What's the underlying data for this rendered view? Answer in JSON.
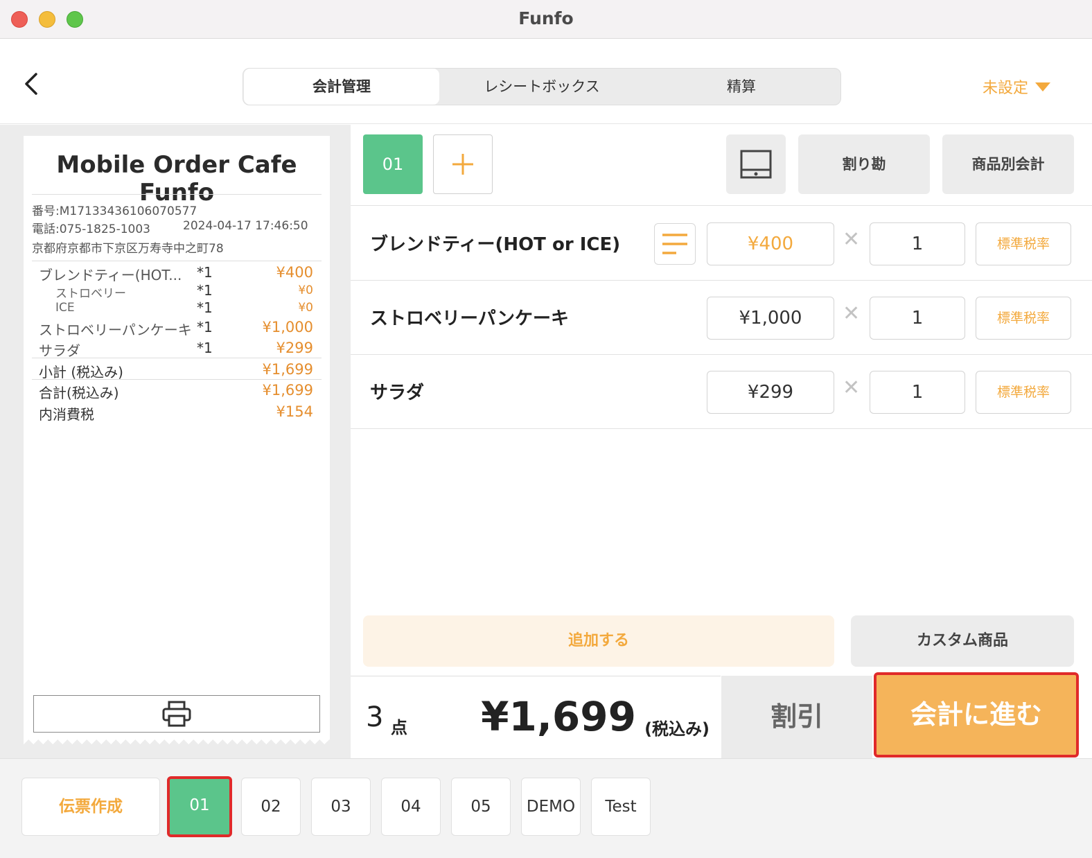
{
  "window": {
    "title": "Funfo"
  },
  "header": {
    "tabs": [
      {
        "label": "会計管理",
        "active": true
      },
      {
        "label": "レシートボックス",
        "active": false
      },
      {
        "label": "精算",
        "active": false
      }
    ],
    "status_label": "未設定"
  },
  "receipt": {
    "shop_name": "Mobile Order Cafe Funfo",
    "number": "番号:M17133436106070577",
    "phone": "電話:075-1825-1003",
    "datetime": "2024-04-17 17:46:50",
    "address": "京都府京都市下京区万寿寺中之町78",
    "items": [
      {
        "name": "ブレンドティー(HOT...",
        "qty": "*1",
        "price": "¥400"
      },
      {
        "name": "ストロベリー",
        "qty": "*1",
        "price": "¥0"
      },
      {
        "name": "ICE",
        "qty": "*1",
        "price": "¥0"
      },
      {
        "name": "ストロベリーパンケーキ",
        "qty": "*1",
        "price": "¥1,000"
      },
      {
        "name": "サラダ",
        "qty": "*1",
        "price": "¥299"
      }
    ],
    "subtotal_label": "小計 (税込み)",
    "subtotal": "¥1,699",
    "total_label": "合計(税込み)",
    "total": "¥1,699",
    "tax_label": "内消費税",
    "tax": "¥154"
  },
  "toolbar": {
    "active_slip": "01",
    "split_label": "割り勘",
    "by_item_label": "商品別会計"
  },
  "order": [
    {
      "name": "ブレンドティー(HOT or ICE)",
      "price": "¥400",
      "qty": "1",
      "tax": "標準税率"
    },
    {
      "name": "ストロベリーパンケーキ",
      "price": "¥1,000",
      "qty": "1",
      "tax": "標準税率"
    },
    {
      "name": "サラダ",
      "price": "¥299",
      "qty": "1",
      "tax": "標準税率"
    }
  ],
  "times_symbol": "✕",
  "actions": {
    "add_label": "追加する",
    "custom_label": "カスタム商品"
  },
  "totals": {
    "count": "3",
    "count_unit": "点",
    "amount": "¥1,699",
    "tax_note": "(税込み)",
    "discount_label": "割引",
    "checkout_label": "会計に進む"
  },
  "bottom": {
    "create_slip_label": "伝票作成",
    "tabs": [
      "01",
      "02",
      "03",
      "04",
      "05",
      "DEMO",
      "Test"
    ]
  },
  "colors": {
    "accent": "#f3a93d",
    "green": "#5bc58b",
    "highlight": "#e02a2a"
  }
}
